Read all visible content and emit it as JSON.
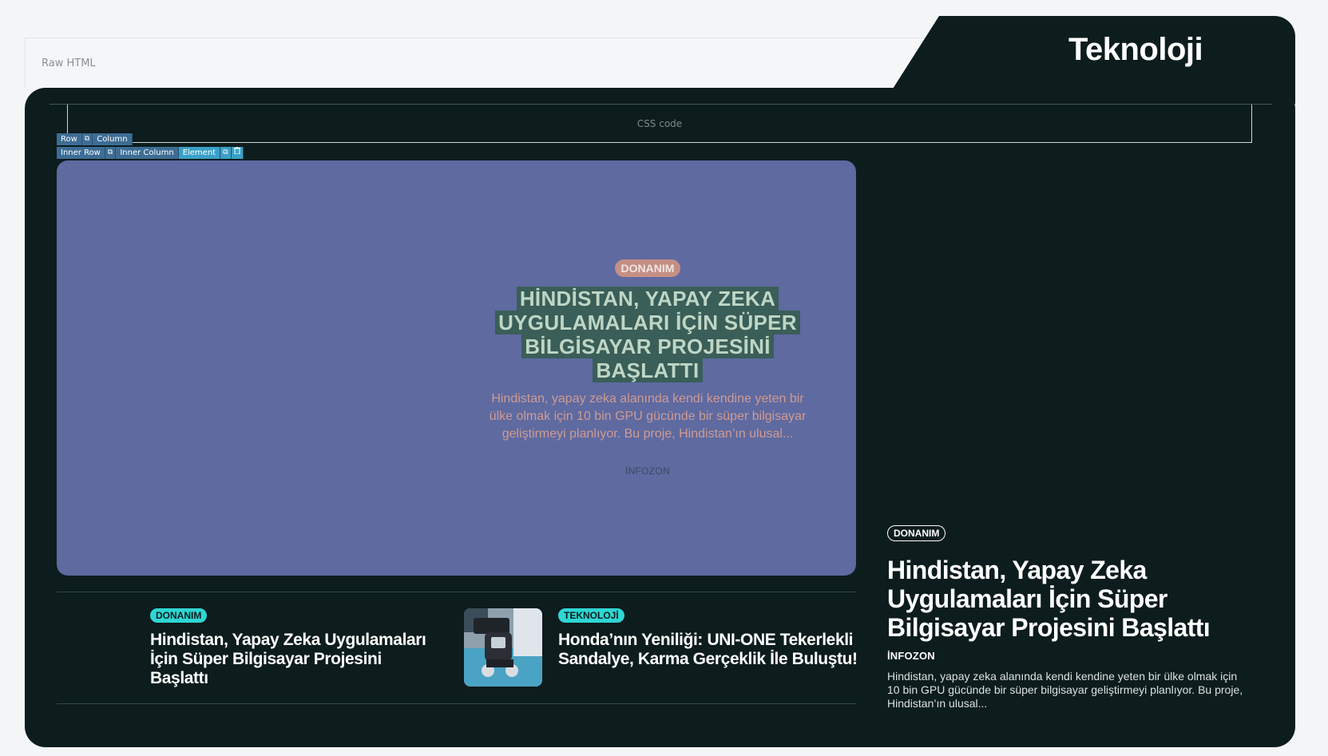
{
  "raw_html": {
    "label": "Raw HTML"
  },
  "section": {
    "title": "Teknoloji"
  },
  "css_box": {
    "label": "CSS code"
  },
  "toolbar": {
    "row": "Row",
    "column": "Column",
    "inner_row": "Inner Row",
    "inner_column": "Inner Column",
    "element": "Element"
  },
  "hero": {
    "badge": "DONANIM",
    "title": "HİNDİSTAN, YAPAY ZEKA UYGULAMALARI İÇİN SÜPER BİLGİSAYAR PROJESİNİ BAŞLATTI",
    "excerpt": "Hindistan, yapay zeka alanında kendi kendine yeten bir ülke olmak için 10 bin GPU gücünde bir süper bilgisayar geliştirmeyi planlıyor. Bu proje, Hindistan’ın ulusal...",
    "source": "İNFOZON"
  },
  "articles": [
    {
      "badge": "DONANIM",
      "title": "Hindistan, Yapay Zeka Uygulamaları İçin Süper Bilgisayar Projesini Başlattı"
    },
    {
      "badge": "TEKNOLOJİ",
      "title": "Honda’nın Yeniliği: UNI-ONE Tekerlekli Sandalye, Karma Gerçeklik İle Buluştu!"
    }
  ],
  "feature": {
    "badge": "DONANIM",
    "title": "Hindistan, Yapay Zeka Uygulamaları İçin Süper Bilgisayar Projesini Başlattı",
    "source": "İNFOZON",
    "excerpt": "Hindistan, yapay zeka alanında kendi kendine yeten bir ülke olmak için 10 bin GPU gücünde bir süper bilgisayar geliştirmeyi planlıyor. Bu proje, Hindistan’ın ulusal..."
  },
  "colors": {
    "panel": "#0d1c1d",
    "hero_bg": "#5e6aa0",
    "badge_cyan": "#2fd6d3",
    "hero_badge": "#c48f85",
    "toolbar_blue": "#3d6d95",
    "element_blue": "#3aa0c7"
  },
  "icons": {
    "duplicate": "duplicate-icon",
    "delete": "trash-icon"
  }
}
